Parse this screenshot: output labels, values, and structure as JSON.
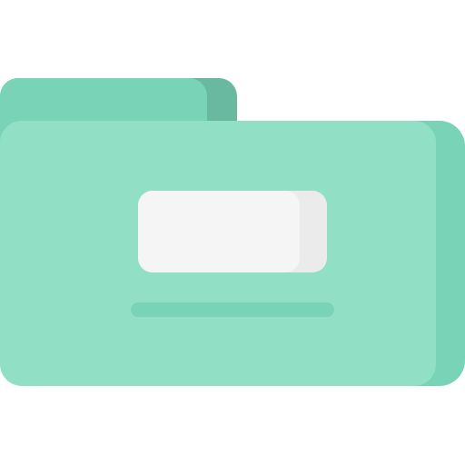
{
  "icon": {
    "name": "folder-icon",
    "colors": {
      "body": "#91e0c5",
      "body_shadow": "#79d3b6",
      "tab": "#79d3b6",
      "tab_shadow": "#69b8a0",
      "label": "#f5f5f5",
      "label_shadow": "#ebebeb",
      "line": "#79d3b6"
    }
  }
}
